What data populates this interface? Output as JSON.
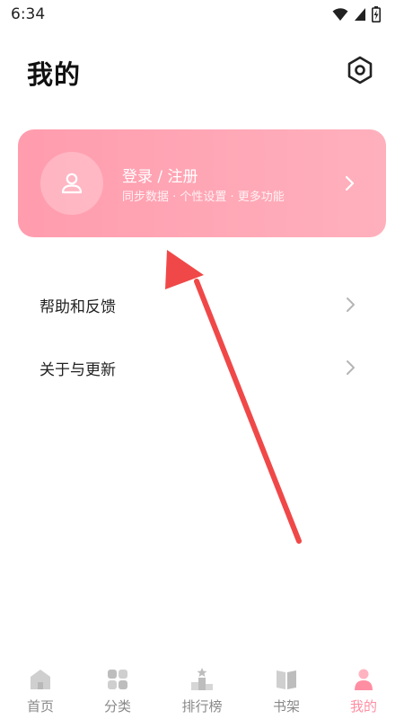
{
  "status_bar": {
    "time": "6:34"
  },
  "header": {
    "title": "我的",
    "settings_icon": "gear-icon"
  },
  "login_card": {
    "title": "登录 / 注册",
    "subtitle": "同步数据 · 个性设置 · 更多功能",
    "avatar_icon": "user-icon",
    "gradient_start": "#ff9cad",
    "gradient_end": "#ffb0bd"
  },
  "menu": [
    {
      "label": "帮助和反馈"
    },
    {
      "label": "关于与更新"
    }
  ],
  "bottom_nav": [
    {
      "label": "首页",
      "icon": "home-icon"
    },
    {
      "label": "分类",
      "icon": "category-icon"
    },
    {
      "label": "排行榜",
      "icon": "ranking-icon"
    },
    {
      "label": "书架",
      "icon": "bookshelf-icon"
    },
    {
      "label": "我的",
      "icon": "profile-icon",
      "active": true
    }
  ],
  "colors": {
    "accent": "#ff8ea3",
    "annotation": "#f04848"
  }
}
